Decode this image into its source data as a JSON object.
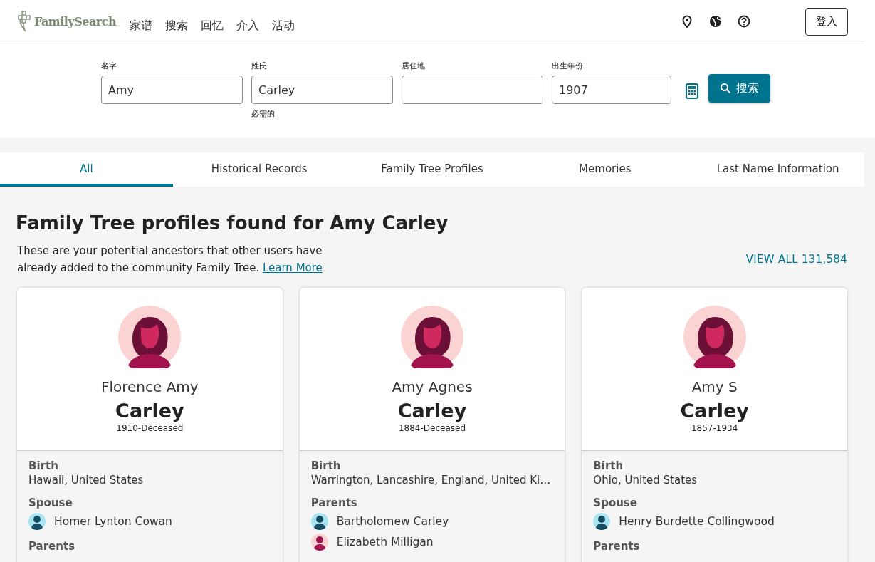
{
  "header": {
    "logo": "FamilySearch",
    "nav": [
      "家谱",
      "搜索",
      "回忆",
      "介入",
      "活动"
    ],
    "signin": "登入"
  },
  "search": {
    "fields": [
      {
        "label": "名字",
        "value": "Amy"
      },
      {
        "label": "姓氏",
        "value": "Carley",
        "hint": "必需的"
      },
      {
        "label": "居住地"
      },
      {
        "label": "出生年份",
        "value": "1907"
      }
    ],
    "button": "搜索"
  },
  "tabs": [
    {
      "label": "All",
      "selected": true
    },
    {
      "label": "Historical Records",
      "selected": false
    },
    {
      "label": "Family Tree Profiles",
      "selected": false
    },
    {
      "label": "Memories",
      "selected": false
    },
    {
      "label": "Last Name Information",
      "selected": false
    }
  ],
  "section": {
    "title": "Family Tree profiles found for Amy Carley",
    "description": "These are your potential ancestors that other users have already added to the community Family Tree.",
    "link": "Learn More",
    "view_all": "VIEW ALL 131,584"
  },
  "cards": [
    {
      "given": "Florence Amy",
      "surname": "Carley",
      "dates": "1910-Deceased",
      "groups": [
        {
          "label": "Birth",
          "text": "Hawaii, United States"
        },
        {
          "label": "Spouse",
          "people": [
            {
              "name": "Homer Lynton Cowan",
              "kind": "male"
            }
          ]
        },
        {
          "label": "Parents"
        }
      ]
    },
    {
      "given": "Amy Agnes",
      "surname": "Carley",
      "dates": "1884-Deceased",
      "groups": [
        {
          "label": "Birth",
          "text": "Warrington, Lancashire, England, United Ki…"
        },
        {
          "label": "Parents",
          "people": [
            {
              "name": "Bartholomew Carley",
              "kind": "male"
            },
            {
              "name": "Elizabeth Milligan",
              "kind": "female"
            }
          ]
        }
      ]
    },
    {
      "given": "Amy S",
      "surname": "Carley",
      "dates": "1857-1934",
      "groups": [
        {
          "label": "Birth",
          "text": "Ohio, United States"
        },
        {
          "label": "Spouse",
          "people": [
            {
              "name": "Henry Burdette Collingwood",
              "kind": "male"
            }
          ]
        },
        {
          "label": "Parents"
        }
      ]
    }
  ]
}
